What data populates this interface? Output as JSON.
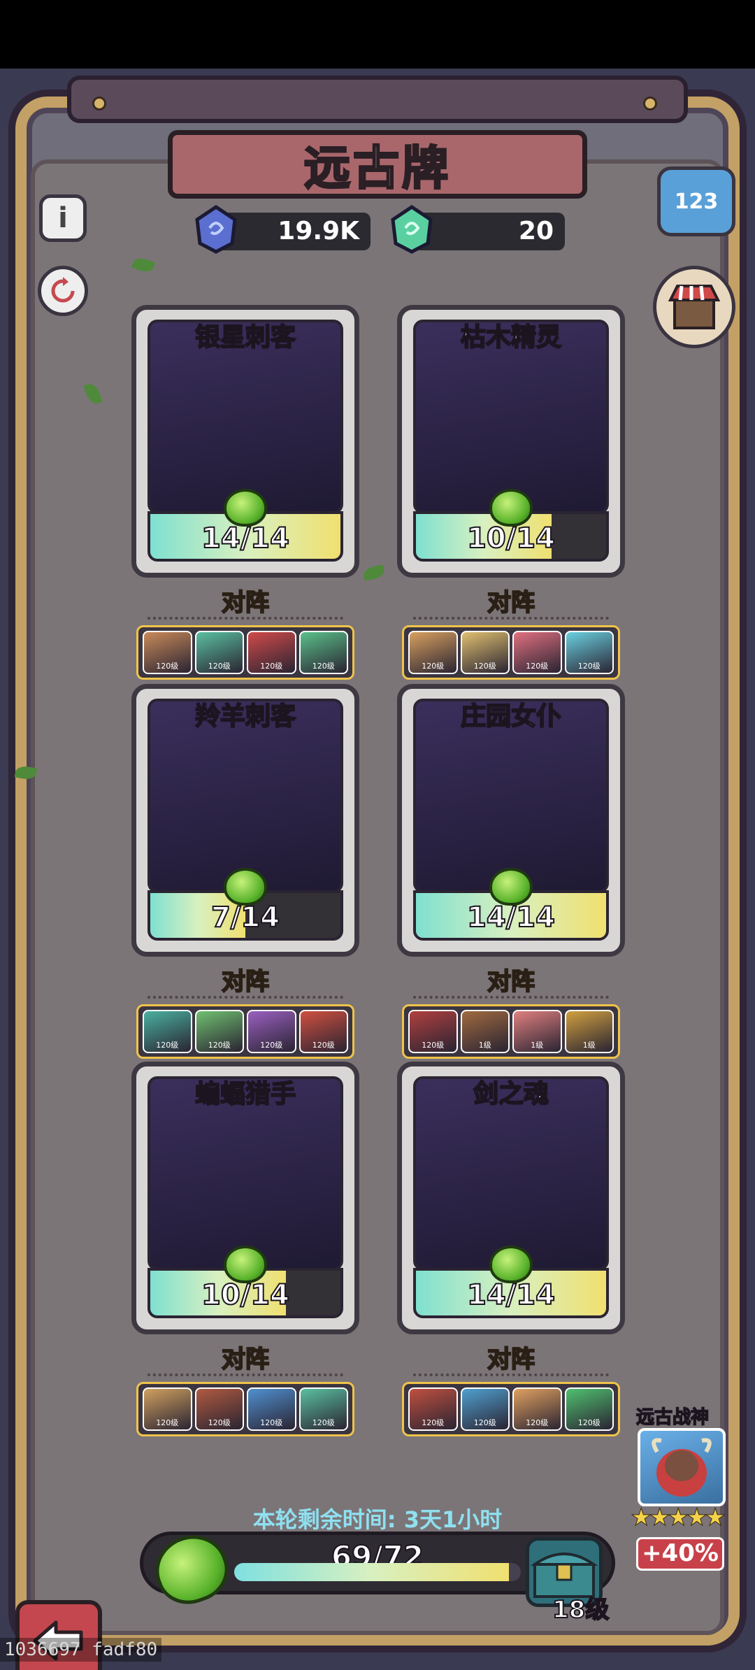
{
  "title": "远古牌",
  "currencies": [
    {
      "icon": "blue-crystal-icon",
      "value": "19.9K"
    },
    {
      "icon": "green-crystal-icon",
      "value": "20"
    }
  ],
  "side_buttons": {
    "info_glyph": "i",
    "ranking_glyphs": "123",
    "shop_icon": "shop-stall-icon",
    "refresh_icon": "refresh-icon"
  },
  "vs_label": "对阵",
  "cards": [
    {
      "name": "银星刺客",
      "progress": "14/14",
      "fill": 1.0,
      "opponents": [
        {
          "level": "120级",
          "color": "#c98a5a"
        },
        {
          "level": "120级",
          "color": "#5ac0a0"
        },
        {
          "level": "120级",
          "color": "#d04a4a"
        },
        {
          "level": "120级",
          "color": "#5ac08a"
        }
      ]
    },
    {
      "name": "枯木精灵",
      "progress": "10/14",
      "fill": 0.714,
      "opponents": [
        {
          "level": "120级",
          "color": "#d8a060"
        },
        {
          "level": "120级",
          "color": "#e0c070"
        },
        {
          "level": "120级",
          "color": "#e07080"
        },
        {
          "level": "120级",
          "color": "#6ad0e0"
        }
      ]
    },
    {
      "name": "羚羊刺客",
      "progress": "7/14",
      "fill": 0.5,
      "opponents": [
        {
          "level": "120级",
          "color": "#4ab0a0"
        },
        {
          "level": "120级",
          "color": "#70c070"
        },
        {
          "level": "120级",
          "color": "#9a60c0"
        },
        {
          "level": "120级",
          "color": "#d05040"
        }
      ]
    },
    {
      "name": "庄园女仆",
      "progress": "14/14",
      "fill": 1.0,
      "opponents": [
        {
          "level": "120级",
          "color": "#b04040"
        },
        {
          "level": "1级",
          "color": "#a06a40"
        },
        {
          "level": "1级",
          "color": "#e08080"
        },
        {
          "level": "1级",
          "color": "#d0a040"
        }
      ]
    },
    {
      "name": "蝙蝠猎手",
      "progress": "10/14",
      "fill": 0.714,
      "opponents": [
        {
          "level": "120级",
          "color": "#d0a060"
        },
        {
          "level": "120级",
          "color": "#b05a40"
        },
        {
          "level": "120级",
          "color": "#5090d0"
        },
        {
          "level": "120级",
          "color": "#5ac0a0"
        }
      ]
    },
    {
      "name": "剑之魂",
      "progress": "14/14",
      "fill": 1.0,
      "opponents": [
        {
          "level": "120级",
          "color": "#c05040"
        },
        {
          "level": "120级",
          "color": "#50a0d0"
        },
        {
          "level": "120级",
          "color": "#e0a060"
        },
        {
          "level": "120级",
          "color": "#50c070"
        }
      ]
    }
  ],
  "timer": "本轮剩余时间: 3天1小时",
  "overall_progress": {
    "text": "69/72",
    "fill": 0.958
  },
  "chest_level": "18级",
  "boss": {
    "label": "远古战神",
    "stars": "★★★★★",
    "bonus": "+40%"
  },
  "debug_text": "1036697 fadf80"
}
